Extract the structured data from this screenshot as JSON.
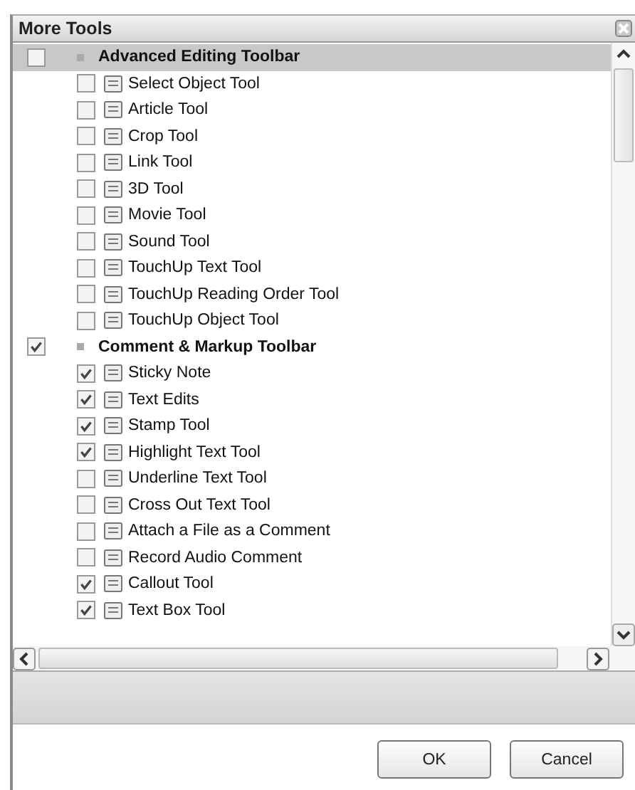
{
  "window": {
    "title": "More Tools"
  },
  "groups": [
    {
      "label": "Advanced Editing Toolbar",
      "checked": false,
      "selected": true,
      "children": [
        {
          "label": "Select Object Tool",
          "checked": false
        },
        {
          "label": "Article Tool",
          "checked": false
        },
        {
          "label": "Crop Tool",
          "checked": false
        },
        {
          "label": "Link Tool",
          "checked": false
        },
        {
          "label": "3D Tool",
          "checked": false
        },
        {
          "label": "Movie Tool",
          "checked": false
        },
        {
          "label": "Sound Tool",
          "checked": false
        },
        {
          "label": "TouchUp Text Tool",
          "checked": false
        },
        {
          "label": "TouchUp Reading Order Tool",
          "checked": false
        },
        {
          "label": "TouchUp Object Tool",
          "checked": false
        }
      ]
    },
    {
      "label": "Comment & Markup Toolbar",
      "checked": true,
      "selected": false,
      "children": [
        {
          "label": "Sticky Note",
          "checked": true
        },
        {
          "label": "Text Edits",
          "checked": true
        },
        {
          "label": "Stamp Tool",
          "checked": true
        },
        {
          "label": "Highlight Text Tool",
          "checked": true
        },
        {
          "label": "Underline Text Tool",
          "checked": false
        },
        {
          "label": "Cross Out Text Tool",
          "checked": false
        },
        {
          "label": "Attach a File as a Comment",
          "checked": false
        },
        {
          "label": "Record Audio Comment",
          "checked": false
        },
        {
          "label": "Callout Tool",
          "checked": true
        },
        {
          "label": "Text Box Tool",
          "checked": true
        }
      ]
    }
  ],
  "buttons": [
    "OK",
    "Cancel"
  ]
}
